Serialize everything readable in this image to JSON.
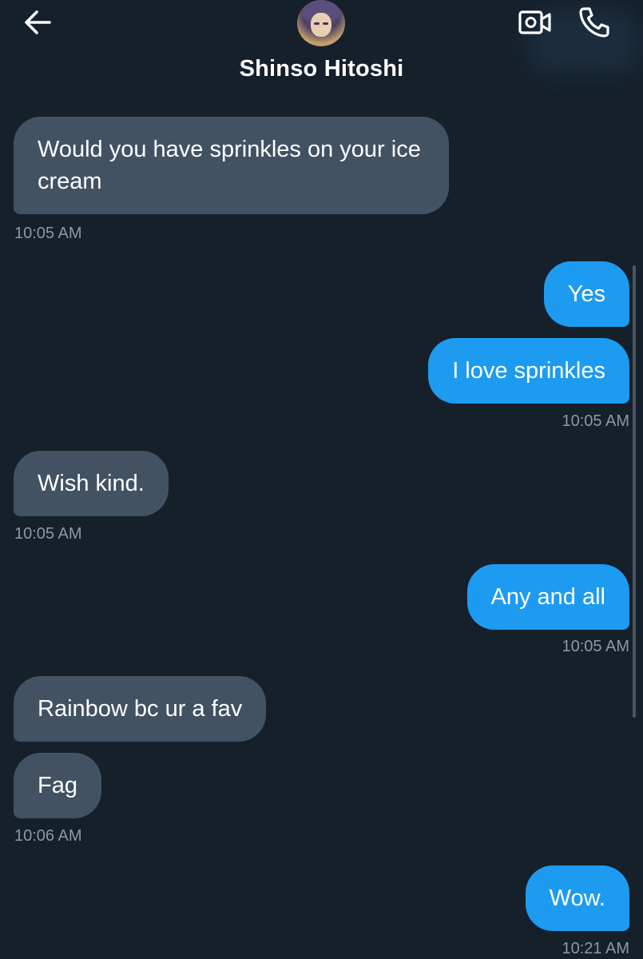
{
  "header": {
    "contact_name": "Shinso Hitoshi"
  },
  "icons": {
    "back": "arrow-left-icon",
    "video": "video-camera-icon",
    "call": "phone-icon"
  },
  "messages": [
    {
      "side": "in",
      "text": "Would you have sprinkles on your ice cream"
    },
    {
      "side": "in",
      "time": "10:05 AM"
    },
    {
      "side": "out",
      "text": "Yes"
    },
    {
      "side": "out",
      "text": "I love sprinkles"
    },
    {
      "side": "out",
      "time": "10:05 AM"
    },
    {
      "side": "in",
      "text": "Wish kind."
    },
    {
      "side": "in",
      "time": "10:05 AM"
    },
    {
      "side": "out",
      "text": "Any and all"
    },
    {
      "side": "out",
      "time": "10:05 AM"
    },
    {
      "side": "in",
      "text": "Rainbow bc ur a fav"
    },
    {
      "side": "in",
      "text": "Fag"
    },
    {
      "side": "in",
      "time": "10:06 AM"
    },
    {
      "side": "out",
      "text": "Wow."
    },
    {
      "side": "out",
      "time": "10:21 AM"
    }
  ],
  "colors": {
    "background": "#15202b",
    "incoming_bubble": "#425263",
    "outgoing_bubble": "#1d9bf0",
    "timestamp": "#8b98a5"
  }
}
